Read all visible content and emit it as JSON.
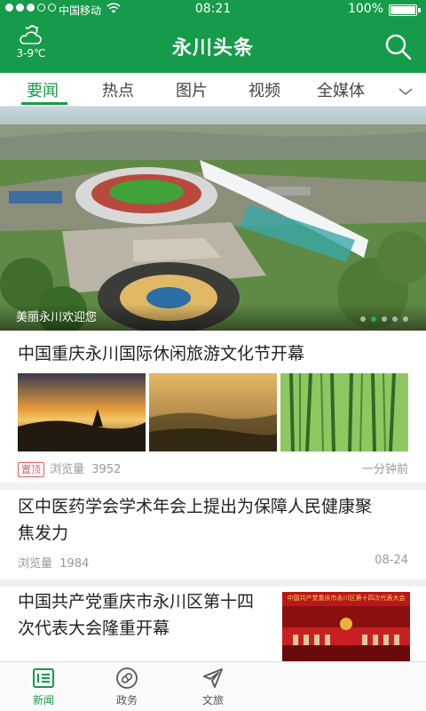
{
  "status_bar": {
    "carrier": "中国移动",
    "time": "08:21",
    "battery": "100%"
  },
  "header": {
    "weather_temp": "3-9℃",
    "title": "永川头条",
    "icons": [
      "cloud-sun-icon",
      "search-icon"
    ]
  },
  "tabs": [
    {
      "label": "要闻",
      "active": true
    },
    {
      "label": "热点",
      "active": false
    },
    {
      "label": "图片",
      "active": false
    },
    {
      "label": "视频",
      "active": false
    },
    {
      "label": "全媒体",
      "active": false
    }
  ],
  "banner": {
    "caption": "美丽永川欢迎您",
    "slides_total": 5,
    "active_slide": 2
  },
  "news": [
    {
      "title": "中国重庆永川国际休闲旅游文化节开幕",
      "badge": "置顶",
      "views_label": "浏览量",
      "views": "3952",
      "time": "一分钟前"
    },
    {
      "title_line1": "区中医药学会学术年会上提出为保障人民健康聚",
      "title_line2": "焦发力",
      "views_label": "浏览量",
      "views": "1984",
      "time": "08-24"
    },
    {
      "title_line1": "中国共产党重庆市永川区第十四",
      "title_line2": "次代表大会隆重开幕",
      "thumb_banner_text": "中国共产党重庆市永川区第十四次代表大会"
    }
  ],
  "bottom_nav": [
    {
      "label": "新闻",
      "icon": "news-icon",
      "active": true
    },
    {
      "label": "政务",
      "icon": "government-icon",
      "active": false
    },
    {
      "label": "文旅",
      "icon": "plane-icon",
      "active": false
    }
  ],
  "colors": {
    "brand_green": "#169b4a",
    "badge_red": "#e25a5a"
  }
}
